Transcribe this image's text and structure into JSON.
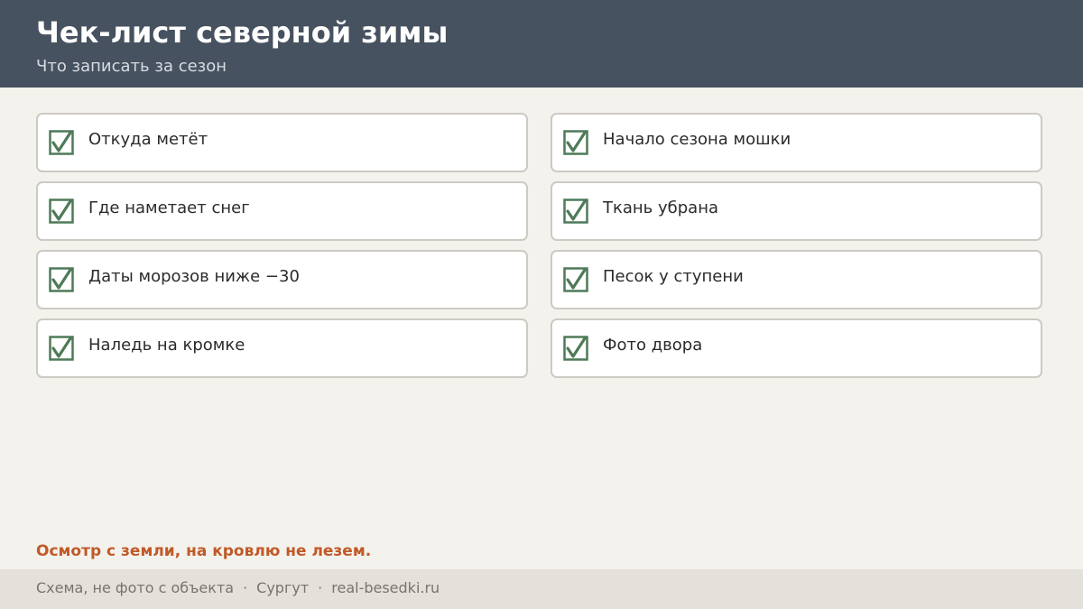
{
  "header": {
    "title": "Чек-лист северной зимы",
    "subtitle": "Что записать за сезон"
  },
  "checklist": {
    "left": [
      {
        "label": "Откуда метёт",
        "checked": true
      },
      {
        "label": "Где наметает снег",
        "checked": true
      },
      {
        "label": "Даты морозов ниже −30",
        "checked": true
      },
      {
        "label": "Наледь на кромке",
        "checked": true
      }
    ],
    "right": [
      {
        "label": "Начало сезона мошки",
        "checked": true
      },
      {
        "label": "Ткань убрана",
        "checked": true
      },
      {
        "label": "Песок у ступени",
        "checked": true
      },
      {
        "label": "Фото двора",
        "checked": true
      }
    ]
  },
  "warning": "Осмотр с земли, на кровлю не лезем.",
  "footer": {
    "note": "Схема, не фото с объекта",
    "separator": "·",
    "city": "Сургут",
    "site": "real-besedki.ru"
  },
  "colors": {
    "header_bg": "#475260",
    "check_green": "#4e7a58",
    "warning": "#c05a28"
  },
  "icons": {
    "checkbox": "checked-checkbox-icon"
  }
}
